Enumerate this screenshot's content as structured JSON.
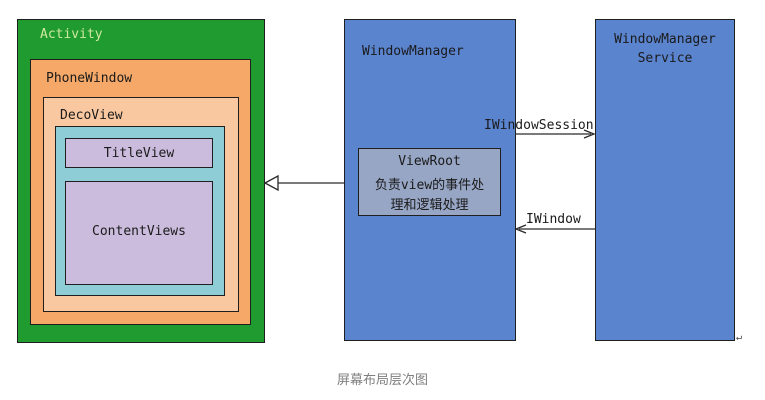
{
  "diagram": {
    "activity": "Activity",
    "phone_window": "PhoneWindow",
    "deco_view": "DecoView",
    "title_view": "TitleView",
    "content_views": "ContentViews",
    "window_manager": "WindowManager",
    "view_root": {
      "line1": "ViewRoot",
      "line2": "负责view的事件处",
      "line3": "理和逻辑处理"
    },
    "wms": {
      "line1": "WindowManager",
      "line2": "Service"
    },
    "edges": {
      "iwindow_session": "IWindowSession",
      "iwindow": "IWindow"
    }
  },
  "caption": "屏幕布局层次图",
  "colors": {
    "activity": "#1f9b2f",
    "phone_window": "#f5a867",
    "deco_view": "#fac8a0",
    "inner": "#8ecdd6",
    "views": "#cbbcdd",
    "window_manager": "#5b84cf",
    "view_root": "#97a6c4"
  }
}
